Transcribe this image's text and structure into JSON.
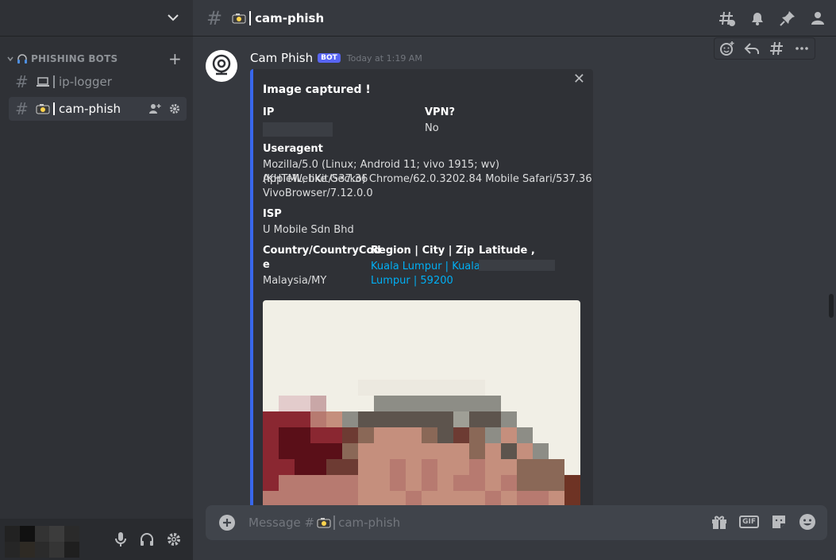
{
  "sidebar": {
    "category": "PHISHING BOTS",
    "channels": [
      {
        "label": "ip-logger"
      },
      {
        "label": "cam-phish"
      }
    ]
  },
  "header": {
    "channel_title": "cam-phish"
  },
  "message": {
    "author": "Cam Phish",
    "bot_tag": "BOT",
    "timestamp": "Today at 1:19 AM",
    "embed": {
      "title": "Image captured !",
      "ip_label": "IP",
      "vpn_label": "VPN?",
      "vpn_value": "No",
      "useragent_label": "Useragent",
      "useragent_lines": [
        "Mozilla/5.0 (Linux; Android 11; vivo 1915; wv) AppleWebKit/537.36",
        "(KHTML, like Gecko) Chrome/62.0.3202.84 Mobile Safari/537.36",
        "VivoBrowser/7.12.0.0"
      ],
      "isp_label": "ISP",
      "isp_value": "U Mobile Sdn Bhd",
      "country_label_lines": [
        "Country/CountryCod",
        "e"
      ],
      "country_value": "Malaysia/MY",
      "region_label": "Region | City | Zip",
      "region_value_lines": [
        "Kuala Lumpur | Kuala",
        "Lumpur | 59200"
      ],
      "latlong_label": "Latitude , Longtitude"
    }
  },
  "composer": {
    "placeholder_prefix": "Message #",
    "placeholder_channel": "cam-phish",
    "gif_label": "GIF"
  },
  "colors": {
    "accent": "#5865f2",
    "embed_bar": "#3867eb",
    "link": "#00aff4"
  },
  "icons": [
    "chevron-down-icon",
    "headphones-icon",
    "laptop-icon",
    "camera-icon",
    "add-member-icon",
    "gear-icon",
    "mic-icon",
    "threads-icon",
    "bell-icon",
    "pin-icon",
    "members-icon",
    "add-reaction-icon",
    "reply-icon",
    "more-icon",
    "close-icon",
    "plus-circle-icon",
    "gift-icon",
    "sticker-icon",
    "emoji-icon"
  ]
}
